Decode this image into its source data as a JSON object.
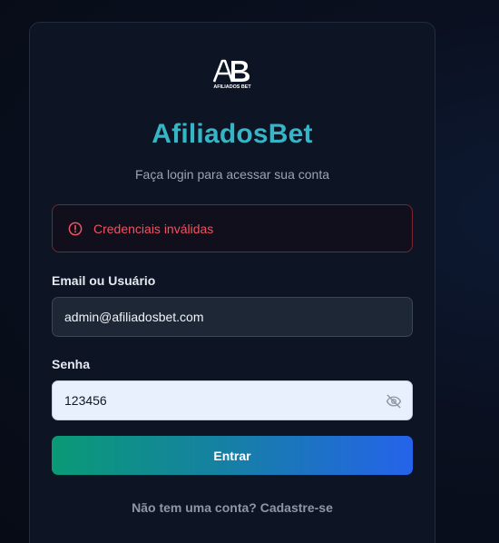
{
  "brand": {
    "name": "AfiliadosBet",
    "logo_text": "AB",
    "logo_subtext": "AFILIADOS BET",
    "accent_color": "#35b5c6"
  },
  "login": {
    "subtitle": "Faça login para acessar sua conta",
    "error": {
      "icon": "alert-circle-icon",
      "message": "Credenciais inválidas",
      "color": "#ef5360"
    },
    "email": {
      "label": "Email ou Usuário",
      "value": "admin@afiliadosbet.com"
    },
    "password": {
      "label": "Senha",
      "value": "123456",
      "toggle_icon": "eye-off-icon"
    },
    "submit_label": "Entrar",
    "signup_prompt": "Não tem uma conta?",
    "signup_link": "Cadastre-se"
  }
}
